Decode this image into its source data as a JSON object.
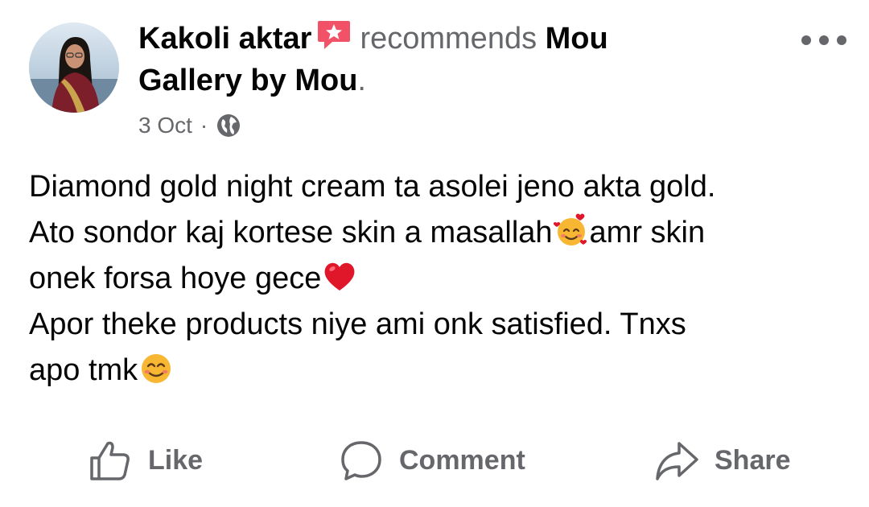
{
  "post": {
    "author": "Kakoli aktar",
    "verb": "recommends",
    "page_name": "Mou Gallery by Mou",
    "date": "3 Oct",
    "separator": "·",
    "privacy_icon": "globe-icon",
    "recommend_icon": "recommendation-badge-icon",
    "more_icon": "more-options-icon",
    "body_lines": [
      "Diamond gold night cream ta asolei jeno akta gold.",
      "Ato sondor kaj kortese skin a masallah",
      "amr skin",
      "onek forsa hoye gece",
      "Apor theke products niye ami onk satisfied. Tnxs",
      "apo tmk"
    ],
    "emojis": [
      "smiling-face-with-hearts-emoji",
      "red-heart-emoji",
      "smiling-face-emoji"
    ]
  },
  "actions": {
    "like": "Like",
    "comment": "Comment",
    "share": "Share"
  },
  "colors": {
    "text": "#050505",
    "secondary": "#65676b",
    "badge": "#f25268",
    "heart": "#e0162b"
  }
}
